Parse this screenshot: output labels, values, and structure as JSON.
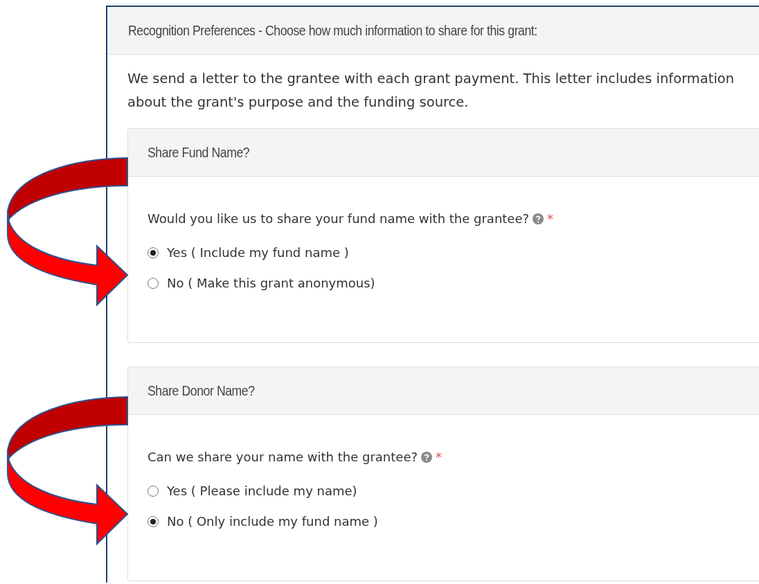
{
  "panel": {
    "title": "Recognition Preferences - Choose how much information to share for this grant:",
    "description": "We send a letter to the grantee with each grant payment. This letter includes information about the grant's purpose and the funding source.",
    "sections": [
      {
        "title": "Share Fund Name?",
        "question": "Would you like us to share your fund name with the grantee?",
        "help": true,
        "required_mark": "*",
        "options": [
          {
            "label": "Yes ( Include my fund name )",
            "selected": true
          },
          {
            "label": "No ( Make this grant anonymous)",
            "selected": false
          }
        ]
      },
      {
        "title": "Share Donor Name?",
        "question": "Can we share your name with the grantee?",
        "help": true,
        "required_mark": "*",
        "options": [
          {
            "label": "Yes ( Please include my name)",
            "selected": false
          },
          {
            "label": "No ( Only include my fund name )",
            "selected": true
          }
        ]
      }
    ]
  }
}
